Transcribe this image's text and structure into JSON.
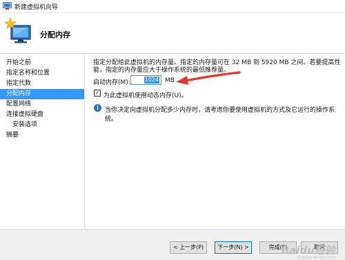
{
  "window": {
    "title": "新建虚拟机向导"
  },
  "header": {
    "title": "分配内存"
  },
  "sidebar": {
    "items": [
      {
        "label": "开始之前"
      },
      {
        "label": "指定名称和位置"
      },
      {
        "label": "指定代数"
      },
      {
        "label": "分配内存"
      },
      {
        "label": "配置网络"
      },
      {
        "label": "连接虚拟硬盘"
      },
      {
        "label": "安装选项"
      },
      {
        "label": "摘要"
      }
    ],
    "active_index": 3
  },
  "main": {
    "description": "指定分配给此虚拟机的内存量。指定的内存量可在 32 MB 到 5920 MB 之间。若要提高性能，指定的内存量应大于操作系统的最低推荐量。",
    "startup_memory_label": "启动内存(M):",
    "startup_memory_value": "1024",
    "startup_memory_unit": "MB",
    "dynamic_memory_label": "为此虚拟机使用动态内存(U)。",
    "dynamic_memory_checked": true,
    "info_text": "当你决定向虚拟机分配多少内存时，请考虑你要使用虚拟机的方式及它运行的操作系统。"
  },
  "footer": {
    "prev": "< 上一步(P)",
    "next": "下一步(N) >",
    "finish": "完成(F)",
    "cancel": "取消"
  },
  "watermark": {
    "text": "Baidu经验",
    "sub": "jingyan.baidu.com"
  },
  "colors": {
    "accent": "#3399ff",
    "arrow": "#e8382b",
    "info": "#1e6fc8"
  }
}
